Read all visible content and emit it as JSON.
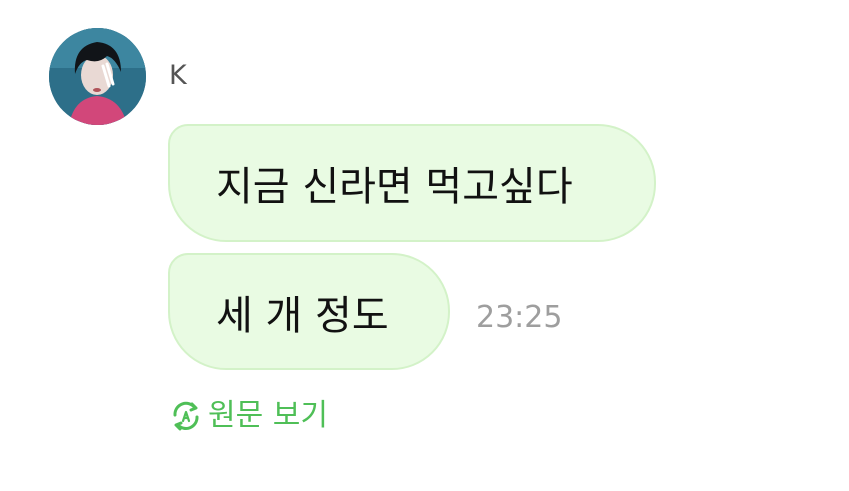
{
  "chat": {
    "sender_name": "K",
    "messages": [
      {
        "text": "지금 신라면 먹고싶다"
      },
      {
        "text": "세 개 정도"
      }
    ],
    "timestamp": "23:25",
    "translate_label": "원문 보기"
  },
  "colors": {
    "bubble_background": "#e9fbe3",
    "bubble_border": "#d3f2c8",
    "link_green": "#4fbf57",
    "timestamp_gray": "#9e9e9e"
  },
  "icons": {
    "translate": "translate-refresh-icon"
  }
}
